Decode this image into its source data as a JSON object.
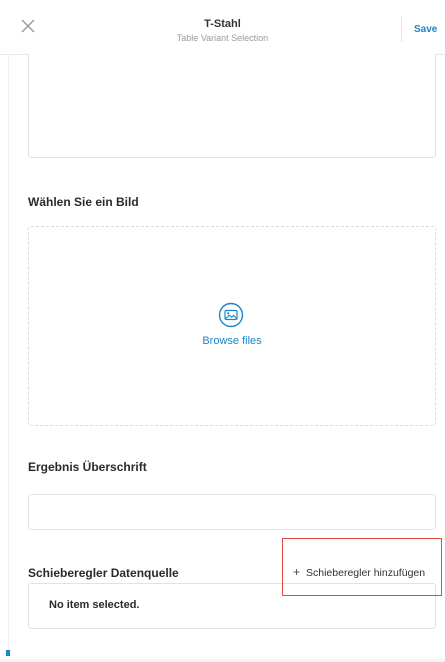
{
  "header": {
    "title": "T-Stahl",
    "subtitle": "Table Variant Selection",
    "close_icon": "close-x-icon",
    "save_label": "Save"
  },
  "image_section": {
    "heading": "Wählen Sie ein Bild",
    "upload_icon": "image-icon",
    "browse_label": "Browse files"
  },
  "result_section": {
    "heading": "Ergebnis Überschrift",
    "input_value": ""
  },
  "slider_section": {
    "heading": "Schieberegler Datenquelle",
    "add_plus": "+",
    "add_label": "Schieberegler hinzufügen",
    "empty_text": "No item selected."
  },
  "colors": {
    "accent": "#1b85c8",
    "highlight": "#e24a3b",
    "border": "#e2e2e2"
  }
}
